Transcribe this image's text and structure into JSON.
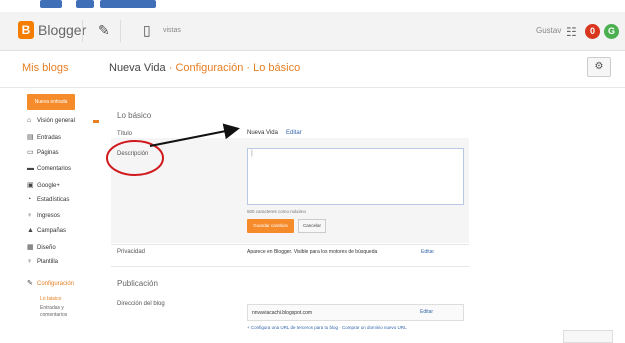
{
  "app": {
    "logo_text": "Blogger",
    "toolbar_small_text": "vistas",
    "user_text": "Gustav",
    "icon_pencil": "pencil-icon",
    "icon_page": "page-icon",
    "icon_grid": "apps-grid-icon",
    "notif_red_count": "0",
    "notif_green_count": "G"
  },
  "header": {
    "my_blogs": "Mis blogs",
    "blog_name": "Nueva Vida",
    "separator": " · ",
    "config": "Configuración",
    "section": "Lo básico"
  },
  "sidebar": {
    "new_entry": "Nueva entrada",
    "items": [
      {
        "label": "Visión general",
        "icon": "home-icon",
        "glyph": "⌂"
      },
      {
        "label": "Entradas",
        "icon": "document-icon",
        "glyph": "▤"
      },
      {
        "label": "Páginas",
        "icon": "pages-icon",
        "glyph": "▭"
      },
      {
        "label": "Comentarios",
        "icon": "comment-icon",
        "glyph": "▬"
      },
      {
        "label": "Google+",
        "icon": "googleplus-icon",
        "glyph": "▣"
      },
      {
        "label": "Estadísticas",
        "icon": "stats-icon",
        "glyph": "◔"
      },
      {
        "label": "Ingresos",
        "icon": "earnings-icon",
        "glyph": "♀"
      },
      {
        "label": "Campañas",
        "icon": "campaign-icon",
        "glyph": "▲"
      },
      {
        "label": "Diseño",
        "icon": "layout-icon",
        "glyph": "▦"
      },
      {
        "label": "Plantilla",
        "icon": "template-icon",
        "glyph": "♀"
      },
      {
        "label": "Configuración",
        "icon": "wrench-icon",
        "glyph": "✎"
      }
    ],
    "sub_items": [
      "Lo básico",
      "Entradas y comentarios"
    ]
  },
  "main": {
    "section_title": "Lo básico",
    "title_label": "Título",
    "title_value": "Nueva Vida",
    "title_edit": "Editar",
    "description_label": "Descripción",
    "description_value": "|",
    "hint": "500 caracteres como máximo",
    "save_button": "Guardar cambios",
    "cancel_button": "Cancelar",
    "privacy_label": "Privacidad",
    "privacy_value": "Aparece en Blogger. Visible para los motores de búsqueda",
    "privacy_edit": "Editar",
    "publication_title": "Publicación",
    "address_label": "Dirección del blog",
    "address_value": "nnvaviacachi.blogspot.com",
    "address_edit": "Editar",
    "address_note": "+ Configura una URL de terceros para tu blog · Comprar un dominio nuevo URL"
  },
  "annotation": {
    "arrow_color": "#111111",
    "circle_color": "#d0191d"
  },
  "colors": {
    "accent": "#f58b2b",
    "link": "#3366aa",
    "topbar": "#f3f3f3"
  }
}
